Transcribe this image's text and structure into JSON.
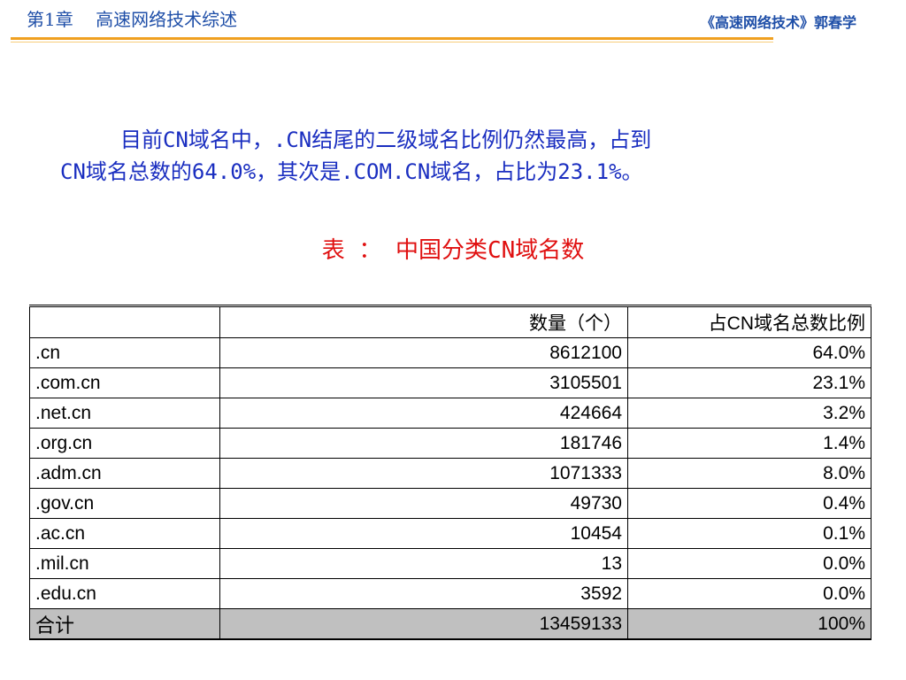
{
  "header": {
    "chapter_title": "第1章    高速网络技术综述",
    "book_credit": "《高速网络技术》郭春学"
  },
  "intro": {
    "line1": "目前CN域名中，.CN结尾的二级域名比例仍然最高，占到",
    "line2": "CN域名总数的64.0%，其次是.COM.CN域名，占比为23.1%。"
  },
  "table_caption": "表 ： 中国分类CN域名数",
  "table": {
    "columns": [
      "",
      "数量（个）",
      "占CN域名总数比例"
    ],
    "rows": [
      {
        "name": ".cn",
        "count": "8612100",
        "ratio": "64.0%"
      },
      {
        "name": ".com.cn",
        "count": "3105501",
        "ratio": "23.1%"
      },
      {
        "name": ".net.cn",
        "count": "424664",
        "ratio": "3.2%"
      },
      {
        "name": ".org.cn",
        "count": "181746",
        "ratio": "1.4%"
      },
      {
        "name": ".adm.cn",
        "count": "1071333",
        "ratio": "8.0%"
      },
      {
        "name": ".gov.cn",
        "count": "49730",
        "ratio": "0.4%"
      },
      {
        "name": ".ac.cn",
        "count": "10454",
        "ratio": "0.1%"
      },
      {
        "name": ".mil.cn",
        "count": "13",
        "ratio": "0.0%"
      },
      {
        "name": ".edu.cn",
        "count": "3592",
        "ratio": "0.0%"
      }
    ],
    "total": {
      "name": "合计",
      "count": "13459133",
      "ratio": "100%"
    }
  },
  "colors": {
    "header_text": "#1f4fa8",
    "header_rule": "#f0a020",
    "intro_text": "#1a2ec0",
    "caption_text": "#e01010",
    "total_row_bg": "#c0c0c0"
  }
}
